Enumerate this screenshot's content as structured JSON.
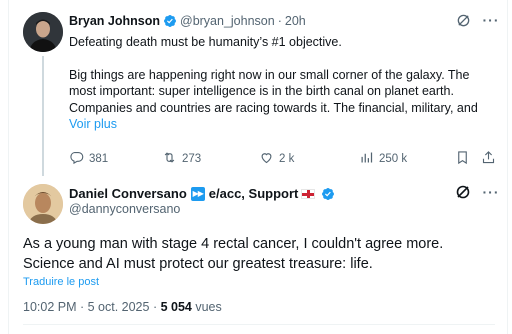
{
  "parent_tweet": {
    "name": "Bryan Johnson",
    "handle": "@bryan_johnson",
    "dot": "·",
    "time": "20h",
    "text_line1": "Defeating death must be humanity’s #1 objective.",
    "text_para2": "Big things are happening right now in our small corner of the galaxy. The most important: super intelligence is in the birth canal on planet earth. Companies and countries are racing towards it. The financial, military, and",
    "more_link": "Voir plus",
    "stats": {
      "replies": "381",
      "reposts": "273",
      "likes": "2 k",
      "views": "250 k"
    }
  },
  "main_tweet": {
    "name": "Daniel Conversano",
    "name_suffix": "e/acc, Support",
    "handle": "@dannyconversano",
    "text": "As a young man with stage 4 rectal cancer, I couldn't agree more. Science and AI must protect our greatest treasure: life.",
    "translate_link": "Traduire le post",
    "timestamp": "10:02 PM · 5 oct. 2025 · ",
    "views_count": "5 054",
    "views_label": " vues"
  },
  "colors": {
    "accent": "#1d9bf0",
    "text": "#0f1419",
    "muted": "#536471"
  }
}
